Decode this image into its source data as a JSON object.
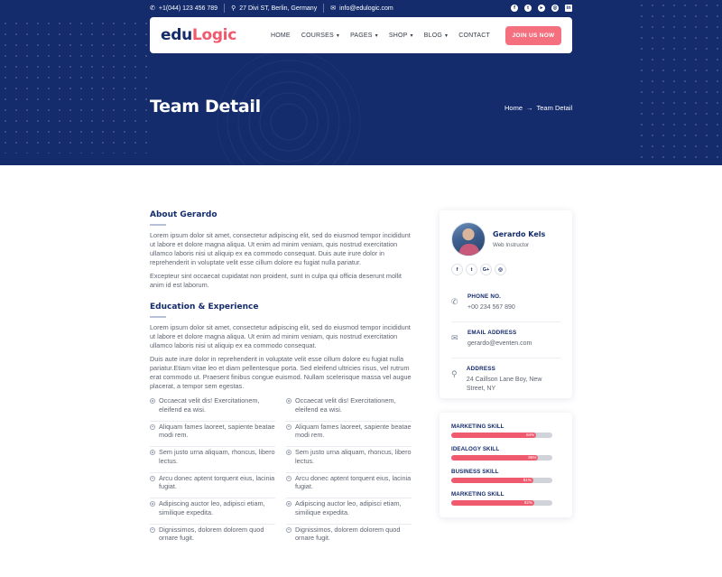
{
  "topbar": {
    "phone": "+1(044) 123 456 789",
    "address": "27 Divi ST, Berlin, Germany",
    "email": "info@edulogic.com",
    "social_icons": [
      "facebook-icon",
      "twitter-icon",
      "youtube-icon",
      "instagram-icon",
      "linkedin-icon"
    ]
  },
  "brand": {
    "logo_e": "e",
    "logo_du": "du",
    "logo_logic": "Logic"
  },
  "nav": {
    "items": [
      {
        "label": "HOME"
      },
      {
        "label": "COURSES"
      },
      {
        "label": "PAGES"
      },
      {
        "label": "SHOP"
      },
      {
        "label": "BLOG"
      },
      {
        "label": "CONTACT"
      }
    ],
    "join_label": "JOIN US NOW"
  },
  "hero": {
    "title": "Team Detail",
    "breadcrumb": {
      "home": "Home",
      "arrow": "→",
      "current": "Team Detail"
    }
  },
  "about": {
    "title": "About Gerardo",
    "p1": "Lorem ipsum dolor sit amet, consectetur adipiscing elit, sed do eiusmod tempor incididunt ut labore et dolore magna aliqua. Ut enim ad minim veniam, quis nostrud exercitation ullamco laboris nisi ut aliquip ex ea commodo consequat. Duis aute irure dolor in reprehenderit in voluptate velit esse cillum dolore eu fugiat nulla pariatur.",
    "p2": "Excepteur sint occaecat cupidatat non proident, sunt in culpa qui officia deserunt mollit anim id est laborum."
  },
  "education": {
    "title": "Education & Experience",
    "p1": "Lorem ipsum dolor sit amet, consectetur adipiscing elit, sed do eiusmod tempor incididunt ut labore et dolore magna aliqua. Ut enim ad minim veniam, quis nostrud exercitation ullamco laboris nisi ut aliquip ex ea commodo consequat.",
    "p2": "Duis aute irure dolor in reprehenderit in voluptate velit esse cillum dolore eu fugiat nulla pariatur.Etiam vitae leo et diam pellentesque porta. Sed eleifend ultricies risus, vel rutrum erat commodo ut. Praesent finibus congue euismod. Nullam scelerisque massa vel augue placerat, a tempor sem egestas.",
    "checks": [
      "Occaecat velit dis! Exercitationem, eleifend ea wisi.",
      "Occaecat velit dis! Exercitationem, eleifend ea wisi.",
      "Aliquam fames laoreet, sapiente beatae modi rem.",
      "Aliquam fames laoreet, sapiente beatae modi rem.",
      "Sem justo urna aliquam, rhoncus, libero lectus.",
      "Sem justo urna aliquam, rhoncus, libero lectus.",
      "Arcu donec aptent torquent eius, lacinia fugiat.",
      "Arcu donec aptent torquent eius, lacinia fugiat.",
      "Adipiscing auctor leo, adipisci etiam, similique expedita.",
      "Adipiscing auctor leo, adipisci etiam, similique expedita.",
      "Dignissimos, dolorem dolorem quod ornare fugit.",
      "Dignissimos, dolorem dolorem quod ornare fugit."
    ]
  },
  "profile": {
    "name": "Gerardo Kels",
    "role": "Web Instructor",
    "social": [
      {
        "icon": "facebook-icon",
        "glyph": "f"
      },
      {
        "icon": "twitter-icon",
        "glyph": "t"
      },
      {
        "icon": "google-plus-icon",
        "glyph": "G+"
      },
      {
        "icon": "instagram-icon",
        "glyph": "◎"
      }
    ],
    "phone_label": "PHONE NO.",
    "phone": "+00 234 567 890",
    "email_label": "EMAIL ADDRESS",
    "email": "gerardo@eventen.com",
    "address_label": "ADDRESS",
    "address": "24 Caillson Lane Boy, New Street, NY"
  },
  "skills": [
    {
      "name": "MARKETING SKILL",
      "percent": 84,
      "label": "84%"
    },
    {
      "name": "IDEALOGY SKILL",
      "percent": 86,
      "label": "86%"
    },
    {
      "name": "BUSINESS SKILL",
      "percent": 81,
      "label": "81%"
    },
    {
      "name": "MARKETING SKILL",
      "percent": 82,
      "label": "82%"
    }
  ],
  "colors": {
    "navy": "#142c6c",
    "accent": "#f05a6e",
    "button": "#f4707e"
  }
}
